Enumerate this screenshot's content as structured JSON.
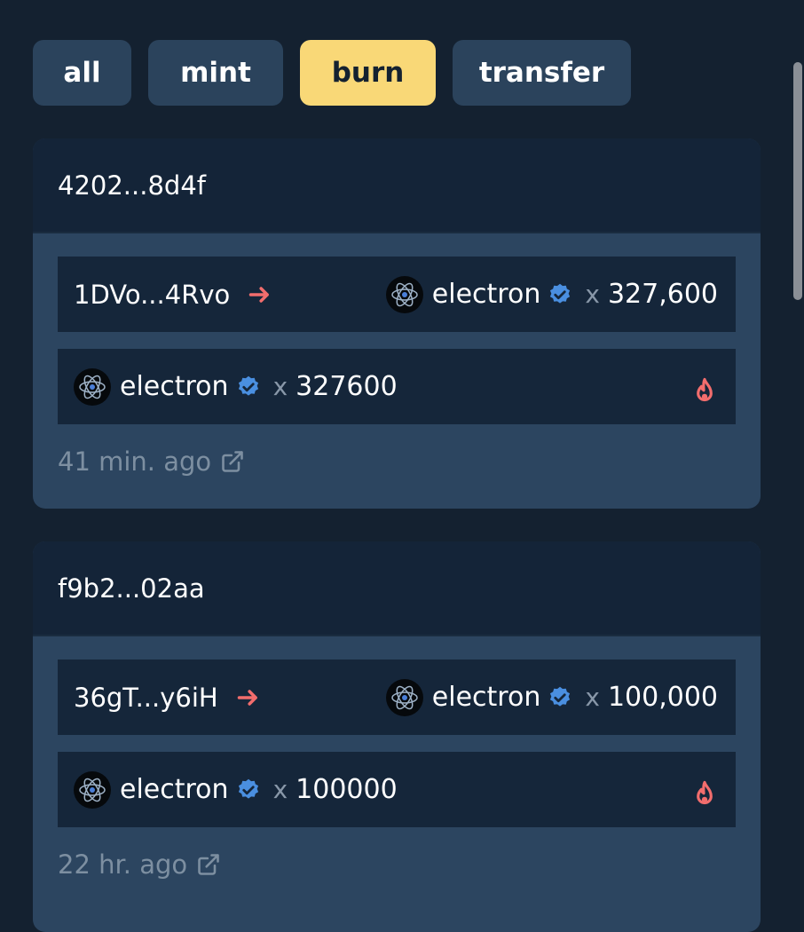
{
  "filters": {
    "all": "all",
    "mint": "mint",
    "burn": "burn",
    "transfer": "transfer",
    "active": "burn"
  },
  "colors": {
    "background": "#142130",
    "chip": "#2b435c",
    "chip_active": "#f9d877",
    "arrow": "#f26d6d",
    "verified": "#4a8fe0",
    "fire": "#f26d6d"
  },
  "transactions": [
    {
      "hash": "4202...8d4f",
      "transfer": {
        "from": "1DVo...4Rvo",
        "token": "electron",
        "times": "x",
        "amount": "327,600"
      },
      "burn": {
        "token": "electron",
        "times": "x",
        "amount": "327600",
        "icon": "fire-icon"
      },
      "time": "41 min. ago"
    },
    {
      "hash": "f9b2...02aa",
      "transfer": {
        "from": "36gT...y6iH",
        "token": "electron",
        "times": "x",
        "amount": "100,000"
      },
      "burn": {
        "token": "electron",
        "times": "x",
        "amount": "100000",
        "icon": "fire-icon"
      },
      "time": "22 hr. ago"
    }
  ]
}
